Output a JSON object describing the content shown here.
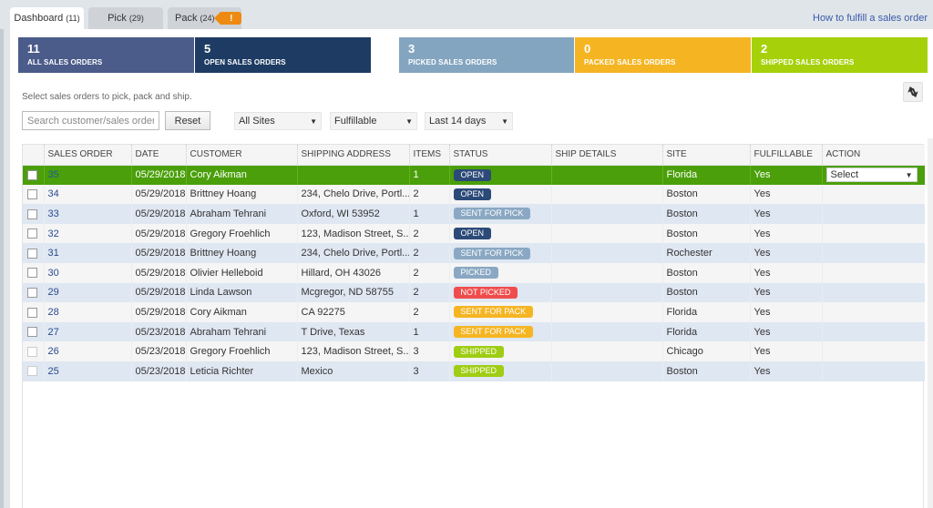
{
  "tabs": [
    {
      "label": "Dashboard",
      "count": "(11)",
      "active": true
    },
    {
      "label": "Pick",
      "count": "(29)",
      "active": false
    },
    {
      "label": "Pack",
      "count": "(24)",
      "active": false,
      "alert": "!"
    }
  ],
  "help_link": "How to fulfill a sales order",
  "summary_cards": [
    {
      "value": "11",
      "label": "ALL SALES ORDERS",
      "color": "#4b5b8a"
    },
    {
      "value": "5",
      "label": "OPEN SALES ORDERS",
      "color": "#1e3c63"
    },
    {
      "value": "3",
      "label": "PICKED SALES ORDERS",
      "color": "#84a5c0"
    },
    {
      "value": "0",
      "label": "PACKED SALES ORDERS",
      "color": "#f5b523"
    },
    {
      "value": "2",
      "label": "SHIPPED SALES ORDERS",
      "color": "#a6d10a"
    }
  ],
  "intro_text": "Select sales orders to pick, pack and ship.",
  "filters": {
    "search_placeholder": "Search customer/sales order",
    "search_value": "",
    "reset_label": "Reset",
    "site": "All Sites",
    "fulfillment": "Fulfillable",
    "period": "Last 14 days"
  },
  "icons": {
    "refresh": "refresh-arrows-icon",
    "caret": "▼"
  },
  "status_colors": {
    "OPEN": "#2c4a78",
    "SENT FOR PICK": "#8aa8c3",
    "PICKED": "#8aa8c3",
    "NOT PICKED": "#ef4d4d",
    "SENT FOR PACK": "#f5b523",
    "SHIPPED": "#9fcd14"
  },
  "table": {
    "columns": [
      "",
      "SALES ORDER",
      "DATE",
      "CUSTOMER",
      "SHIPPING ADDRESS",
      "ITEMS",
      "STATUS",
      "SHIP DETAILS",
      "SITE",
      "FULFILLABLE",
      "ACTION"
    ],
    "rows": [
      {
        "so": "35",
        "date": "05/29/2018",
        "customer": "Cory Aikman",
        "address": "",
        "items": "1",
        "status": "OPEN",
        "ship_details": "",
        "site": "Florida",
        "fulfillable": "Yes",
        "action": "Select",
        "selected": true
      },
      {
        "so": "34",
        "date": "05/29/2018",
        "customer": "Brittney Hoang",
        "address": "234, Chelo Drive, Portl...",
        "items": "2",
        "status": "OPEN",
        "ship_details": "",
        "site": "Boston",
        "fulfillable": "Yes",
        "action": ""
      },
      {
        "so": "33",
        "date": "05/29/2018",
        "customer": "Abraham Tehrani",
        "address": "Oxford, WI 53952",
        "items": "1",
        "status": "SENT FOR PICK",
        "ship_details": "",
        "site": "Boston",
        "fulfillable": "Yes",
        "action": ""
      },
      {
        "so": "32",
        "date": "05/29/2018",
        "customer": "Gregory Froehlich",
        "address": "123, Madison Street, S...",
        "items": "2",
        "status": "OPEN",
        "ship_details": "",
        "site": "Boston",
        "fulfillable": "Yes",
        "action": ""
      },
      {
        "so": "31",
        "date": "05/29/2018",
        "customer": "Brittney Hoang",
        "address": "234, Chelo Drive, Portl...",
        "items": "2",
        "status": "SENT FOR PICK",
        "ship_details": "",
        "site": "Rochester",
        "fulfillable": "Yes",
        "action": ""
      },
      {
        "so": "30",
        "date": "05/29/2018",
        "customer": "Olivier Helleboid",
        "address": "Hillard, OH 43026",
        "items": "2",
        "status": "PICKED",
        "ship_details": "",
        "site": "Boston",
        "fulfillable": "Yes",
        "action": ""
      },
      {
        "so": "29",
        "date": "05/29/2018",
        "customer": "Linda Lawson",
        "address": "Mcgregor, ND 58755",
        "items": "2",
        "status": "NOT PICKED",
        "ship_details": "",
        "site": "Boston",
        "fulfillable": "Yes",
        "action": ""
      },
      {
        "so": "28",
        "date": "05/29/2018",
        "customer": "Cory Aikman",
        "address": "CA 92275",
        "items": "2",
        "status": "SENT FOR PACK",
        "ship_details": "",
        "site": "Florida",
        "fulfillable": "Yes",
        "action": ""
      },
      {
        "so": "27",
        "date": "05/23/2018",
        "customer": "Abraham Tehrani",
        "address": "T Drive, Texas",
        "items": "1",
        "status": "SENT FOR PACK",
        "ship_details": "",
        "site": "Florida",
        "fulfillable": "Yes",
        "action": ""
      },
      {
        "so": "26",
        "date": "05/23/2018",
        "customer": "Gregory Froehlich",
        "address": "123, Madison Street, S...",
        "items": "3",
        "status": "SHIPPED",
        "ship_details": "",
        "site": "Chicago",
        "fulfillable": "Yes",
        "action": "",
        "checkbox_disabled": true
      },
      {
        "so": "25",
        "date": "05/23/2018",
        "customer": "Leticia Richter",
        "address": "Mexico",
        "items": "3",
        "status": "SHIPPED",
        "ship_details": "",
        "site": "Boston",
        "fulfillable": "Yes",
        "action": "",
        "checkbox_disabled": true
      }
    ]
  }
}
